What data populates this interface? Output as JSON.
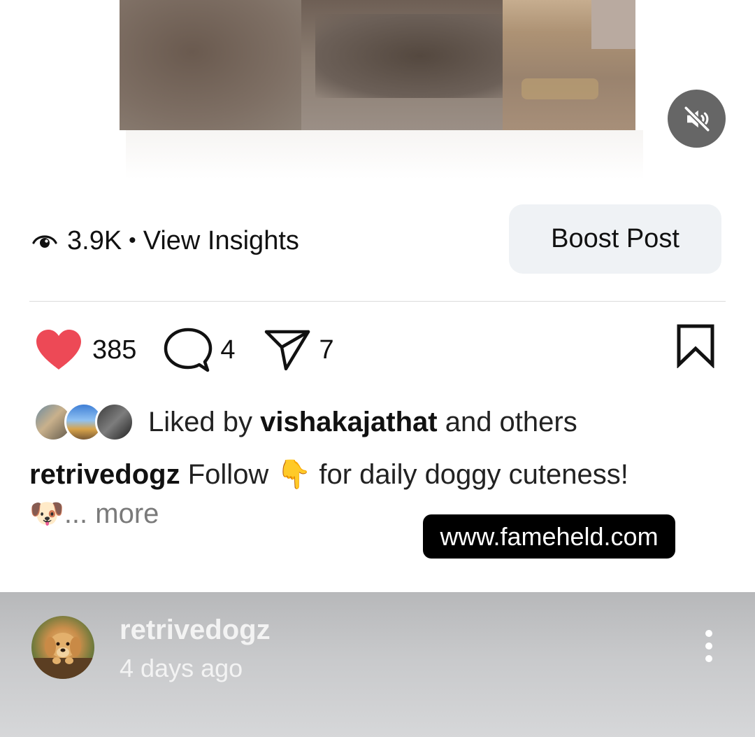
{
  "media": {
    "mute_icon": "speaker-muted-icon"
  },
  "insights": {
    "views": "3.9K",
    "separator": "•",
    "link_label": "View Insights",
    "icon": "eye-icon"
  },
  "boost": {
    "label": "Boost Post"
  },
  "actions": {
    "likes": "385",
    "comments": "4",
    "shares": "7",
    "like_color": "#ed4956",
    "icons": [
      "heart-filled-icon",
      "comment-icon",
      "share-icon",
      "bookmark-icon"
    ]
  },
  "liked_by": {
    "prefix": "Liked by",
    "user": "vishakajathat",
    "suffix": "and others"
  },
  "caption": {
    "username": "retrivedogz",
    "text_before_emoji": "Follow",
    "emoji1": "👇",
    "text_after_emoji": "for daily doggy cuteness!",
    "emoji2": "🐶",
    "ellipsis": "...",
    "more_label": "more"
  },
  "watermark": {
    "text": "www.fameheld.com"
  },
  "next_post": {
    "username": "retrivedogz",
    "time": "4 days ago",
    "menu_icon": "more-vertical-icon"
  }
}
